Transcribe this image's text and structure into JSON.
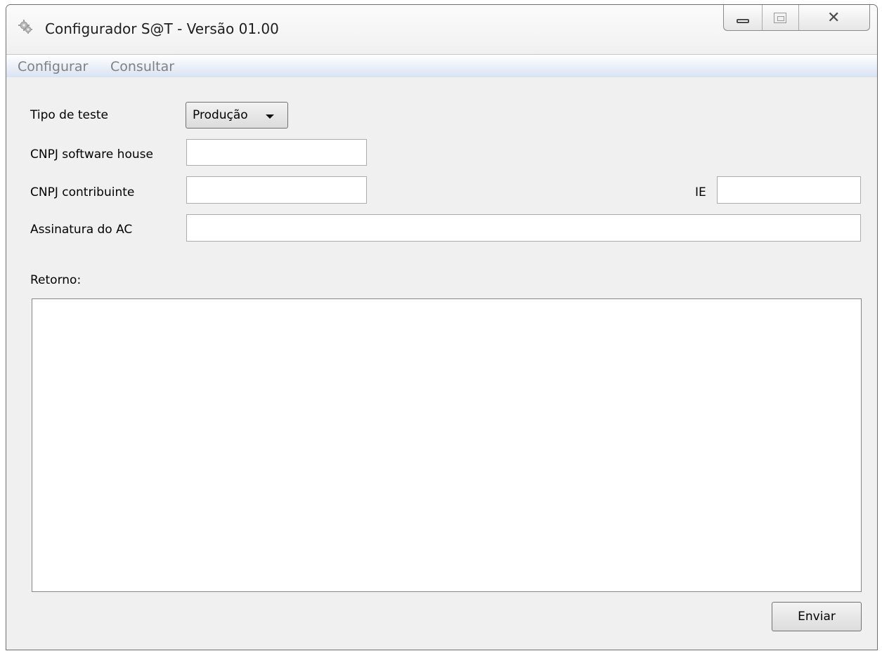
{
  "window": {
    "title": "Configurador S@T - Versão 01.00",
    "icon": "gear-icon"
  },
  "menu": {
    "items": [
      {
        "label": "Configurar"
      },
      {
        "label": "Consultar"
      }
    ]
  },
  "form": {
    "tipo_teste": {
      "label": "Tipo de teste",
      "selected": "Produção"
    },
    "cnpj_software_house": {
      "label": "CNPJ software house",
      "value": ""
    },
    "cnpj_contribuinte": {
      "label": "CNPJ contribuinte",
      "value": ""
    },
    "ie": {
      "label": "IE",
      "value": ""
    },
    "assinatura_ac": {
      "label": "Assinatura do AC",
      "value": ""
    },
    "retorno": {
      "label": "Retorno:",
      "value": ""
    }
  },
  "actions": {
    "send_label": "Enviar"
  }
}
